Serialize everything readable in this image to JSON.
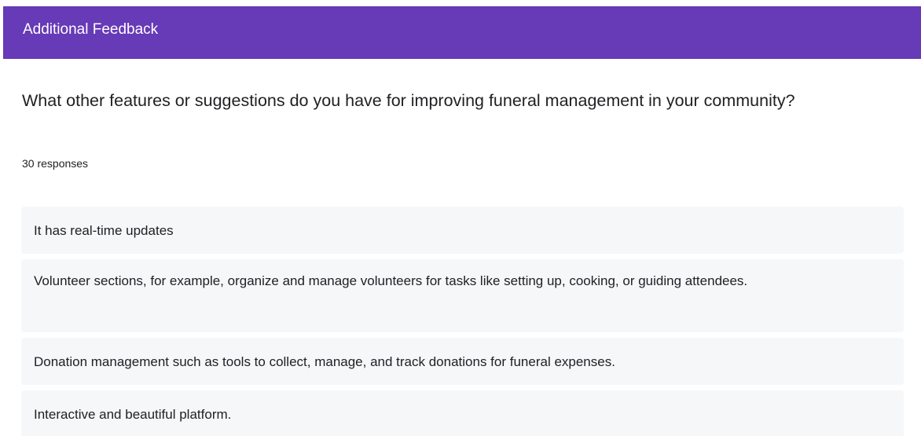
{
  "section": {
    "title": "Additional Feedback"
  },
  "question": {
    "text": "What other features or suggestions do you have for improving funeral management in your community?",
    "response_count": "30 responses"
  },
  "responses": [
    "It has real-time updates",
    "Volunteer sections, for example, organize and manage volunteers for tasks like setting up, cooking, or guiding attendees.",
    "Donation management such as tools to collect, manage, and track donations for funeral expenses.",
    "Interactive and beautiful platform."
  ],
  "colors": {
    "header_bg": "#673ab7",
    "response_bg": "#f6f7f9",
    "text": "#202124"
  }
}
